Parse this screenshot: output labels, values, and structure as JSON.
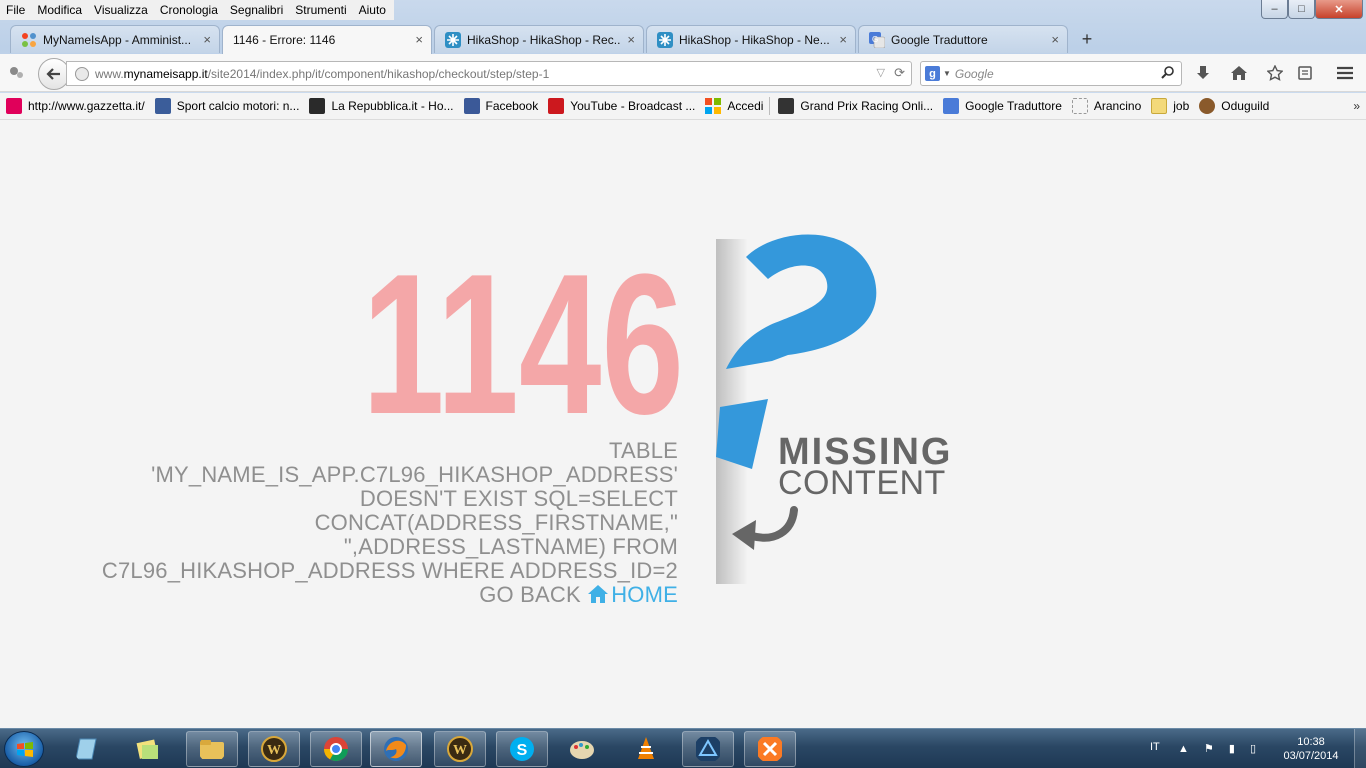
{
  "menubar": {
    "items": [
      "File",
      "Modifica",
      "Visualizza",
      "Cronologia",
      "Segnalibri",
      "Strumenti",
      "Aiuto"
    ]
  },
  "window": {
    "minimize": "–",
    "maximize": "□",
    "close": "✕"
  },
  "tabs": [
    {
      "label": "MyNameIsApp - Amminist...",
      "icon": "joomla-icon",
      "active": false
    },
    {
      "label": "1146 - Errore: 1146",
      "icon": "none",
      "active": true
    },
    {
      "label": "HikaShop - HikaShop - Rec...",
      "icon": "hikashop-icon",
      "active": false
    },
    {
      "label": "HikaShop - HikaShop - Ne...",
      "icon": "hikashop-icon",
      "active": false
    },
    {
      "label": "Google Traduttore",
      "icon": "google-translate-icon",
      "active": false
    }
  ],
  "tab_close": "×",
  "new_tab": "+",
  "address": {
    "prefix": "www.",
    "domain": "mynameisapp.it",
    "path": "/site2014/index.php/it/component/hikashop/checkout/step/step-1"
  },
  "search": {
    "placeholder": "Google",
    "engine_letter": "g"
  },
  "bookmarks": [
    {
      "label": "http://www.gazzetta.it/",
      "icon": "gazzetta-icon",
      "color": "#e0005a"
    },
    {
      "label": "Sport calcio motori: n...",
      "icon": "sport-icon",
      "color": "#3b5d9a"
    },
    {
      "label": "La Repubblica.it - Ho...",
      "icon": "repubblica-icon",
      "color": "#2a2a2a"
    },
    {
      "label": "Facebook",
      "icon": "facebook-icon",
      "color": "#3b5998"
    },
    {
      "label": "YouTube - Broadcast ...",
      "icon": "youtube-icon",
      "color": "#cc181e"
    },
    {
      "label": "Accedi",
      "icon": "microsoft-icon",
      "color": "#f25022"
    },
    {
      "label": "Grand Prix Racing Onli...",
      "icon": "gpro-icon",
      "color": "#333333"
    },
    {
      "label": "Google Traduttore",
      "icon": "google-translate-icon",
      "color": "#4a7bd8"
    },
    {
      "label": "Arancino",
      "icon": "page-icon",
      "color": "#cccccc"
    },
    {
      "label": "job",
      "icon": "folder-icon",
      "color": "#f3d97a"
    },
    {
      "label": "Oduguild",
      "icon": "oduguild-icon",
      "color": "#8a5a2b"
    }
  ],
  "bookmarks_more": "»",
  "error": {
    "code": "1146",
    "message": "TABLE 'MY_NAME_IS_APP.C7L96_HIKASHOP_ADDRESS' DOESN'T EXIST SQL=SELECT CONCAT(ADDRESS_FIRSTNAME,\" \",ADDRESS_LASTNAME) FROM C7L96_HIKASHOP_ADDRESS WHERE ADDRESS_ID=2",
    "go_back": "GO BACK",
    "home": "HOME",
    "code_color": "#f4a7a8",
    "accent_color": "#3498db",
    "text_color": "#8f8f8f",
    "link_color": "#3fb0e6"
  },
  "missing": {
    "line1": "MISSING",
    "line2": "CONTENT"
  },
  "taskbar": {
    "apps": [
      {
        "name": "start-button"
      },
      {
        "name": "notes-icon"
      },
      {
        "name": "sticky-notes-icon"
      },
      {
        "name": "explorer-icon"
      },
      {
        "name": "wow-icon"
      },
      {
        "name": "chrome-icon"
      },
      {
        "name": "firefox-icon"
      },
      {
        "name": "wow-icon"
      },
      {
        "name": "skype-icon"
      },
      {
        "name": "paint-icon"
      },
      {
        "name": "vlc-icon"
      },
      {
        "name": "app-icon"
      },
      {
        "name": "xampp-icon"
      }
    ],
    "lang": "IT",
    "tray": "▲ ⚑ ▮ ▯",
    "time": "10:38",
    "date": "03/07/2014"
  }
}
